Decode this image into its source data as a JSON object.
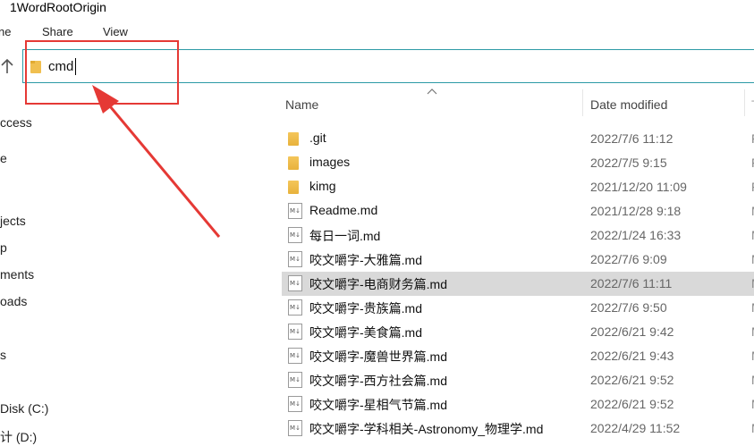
{
  "window": {
    "title": "1WordRootOrigin"
  },
  "menu": [
    "ne",
    "Share",
    "View"
  ],
  "address": {
    "value": "cmd"
  },
  "nav": [
    {
      "label": "ccess"
    },
    {
      "label": "e"
    },
    {
      "label": "jects"
    },
    {
      "label": "p"
    },
    {
      "label": "ments"
    },
    {
      "label": "oads"
    },
    {
      "label": "s"
    },
    {
      "label": "Disk (C:)"
    },
    {
      "label": "计 (D:)"
    }
  ],
  "columns": {
    "name": "Name",
    "date_modified": "Date modified",
    "type": "T"
  },
  "files": [
    {
      "name": ".git",
      "icon": "folder-icon",
      "date": "2022/7/6 11:12",
      "type": "F"
    },
    {
      "name": "images",
      "icon": "folder-icon",
      "date": "2022/7/5 9:15",
      "type": "F"
    },
    {
      "name": "kimg",
      "icon": "folder-icon",
      "date": "2021/12/20 11:09",
      "type": "F"
    },
    {
      "name": "Readme.md",
      "icon": "markdown-file-icon",
      "date": "2021/12/28 9:18",
      "type": "M"
    },
    {
      "name": "每日一词.md",
      "icon": "markdown-file-icon",
      "date": "2022/1/24 16:33",
      "type": "M"
    },
    {
      "name": "咬文嚼字-大雅篇.md",
      "icon": "markdown-file-icon",
      "date": "2022/7/6 9:09",
      "type": "M"
    },
    {
      "name": "咬文嚼字-电商财务篇.md",
      "icon": "markdown-file-icon",
      "date": "2022/7/6 11:11",
      "type": "M",
      "selected": true
    },
    {
      "name": "咬文嚼字-贵族篇.md",
      "icon": "markdown-file-icon",
      "date": "2022/7/6 9:50",
      "type": "M"
    },
    {
      "name": "咬文嚼字-美食篇.md",
      "icon": "markdown-file-icon",
      "date": "2022/6/21 9:42",
      "type": "M"
    },
    {
      "name": "咬文嚼字-魔兽世界篇.md",
      "icon": "markdown-file-icon",
      "date": "2022/6/21 9:43",
      "type": "M"
    },
    {
      "name": "咬文嚼字-西方社会篇.md",
      "icon": "markdown-file-icon",
      "date": "2022/6/21 9:52",
      "type": "M"
    },
    {
      "name": "咬文嚼字-星相气节篇.md",
      "icon": "markdown-file-icon",
      "date": "2022/6/21 9:52",
      "type": "M"
    },
    {
      "name": "咬文嚼字-学科相关-Astronomy_物理学.md",
      "icon": "markdown-file-icon",
      "date": "2022/4/29 11:52",
      "type": "M"
    }
  ],
  "colors": {
    "accent": "#2c9aa6",
    "highlight": "#e53935",
    "selected_row": "#d9d9d9",
    "folder": "#f4c65a"
  }
}
